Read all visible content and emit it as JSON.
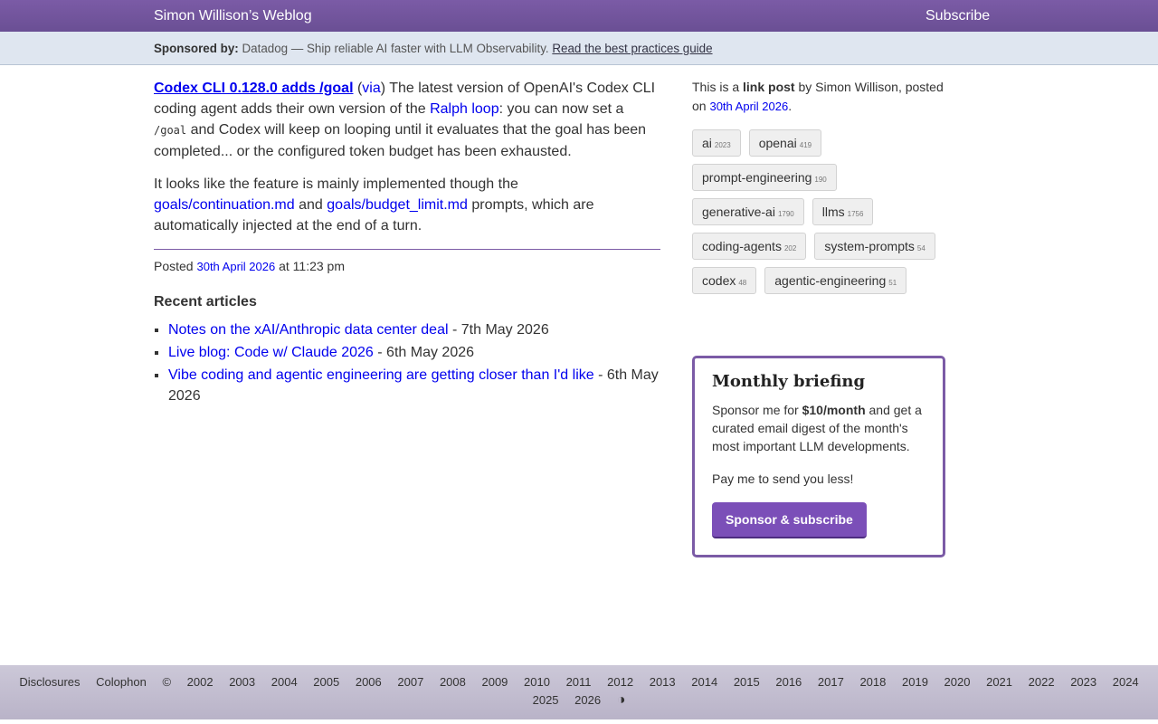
{
  "header": {
    "site_title": "Simon Willison’s Weblog",
    "subscribe": "Subscribe"
  },
  "sponsor_bar": {
    "label": "Sponsored by:",
    "text": "Datadog — Ship reliable AI faster with LLM Observability.",
    "link": "Read the best practices guide"
  },
  "post": {
    "title": "Codex CLI 0.128.0 adds /goal",
    "via": "via",
    "text_1": "The latest version of OpenAI's Codex CLI coding agent adds their own version of the",
    "ralph_link": "Ralph loop",
    "text_2": ": you can now set a",
    "code_goal": "/goal",
    "text_3": "and Codex will keep on looping until it evaluates that the goal has been completed... or the configured token budget has been exhausted.",
    "para2_start": "It looks like the feature is mainly implemented though the",
    "link_continuation": "goals/continuation.md",
    "and": "and",
    "link_budget": "goals/budget_limit.md",
    "para2_end": "prompts, which are automatically injected at the end of a turn.",
    "posted_label": "Posted",
    "posted_date": "30th April 2026",
    "posted_time": "at 11:23 pm"
  },
  "recent": {
    "heading": "Recent articles",
    "items": [
      {
        "title": "Notes on the xAI/Anthropic data center deal",
        "date": "- 7th May 2026"
      },
      {
        "title": "Live blog: Code w/ Claude 2026",
        "date": "- 6th May 2026"
      },
      {
        "title": "Vibe coding and agentic engineering are getting closer than I'd like",
        "date": "- 6th May 2026"
      }
    ]
  },
  "sidebar": {
    "meta_prefix": "This is a",
    "meta_bold": "link post",
    "meta_by": "by Simon Willison, posted on",
    "meta_date": "30th April 2026",
    "meta_end": ".",
    "tags": [
      {
        "name": "ai",
        "count": "2023"
      },
      {
        "name": "openai",
        "count": "419"
      },
      {
        "name": "prompt-engineering",
        "count": "190"
      },
      {
        "name": "generative-ai",
        "count": "1790"
      },
      {
        "name": "llms",
        "count": "1756"
      },
      {
        "name": "coding-agents",
        "count": "202"
      },
      {
        "name": "system-prompts",
        "count": "54"
      },
      {
        "name": "codex",
        "count": "48"
      },
      {
        "name": "agentic-engineering",
        "count": "51"
      }
    ]
  },
  "briefing": {
    "title": "Monthly briefing",
    "text_pre": "Sponsor me for",
    "price": "$10/month",
    "text_post": "and get a curated email digest of the month's most important LLM developments.",
    "tagline": "Pay me to send you less!",
    "button": "Sponsor & subscribe"
  },
  "footer": {
    "disclosures": "Disclosures",
    "colophon": "Colophon",
    "copyright": "©",
    "years": [
      "2002",
      "2003",
      "2004",
      "2005",
      "2006",
      "2007",
      "2008",
      "2009",
      "2010",
      "2011",
      "2012",
      "2013",
      "2014",
      "2015",
      "2016",
      "2017",
      "2018",
      "2019",
      "2020",
      "2021",
      "2022",
      "2023",
      "2024",
      "2025",
      "2026"
    ],
    "theme_icon": "◑"
  },
  "colors": {
    "brand_purple": "#7b5ba6",
    "link_blue": "#0000ee",
    "sponsor_bar_bg": "#dfe6f0"
  }
}
